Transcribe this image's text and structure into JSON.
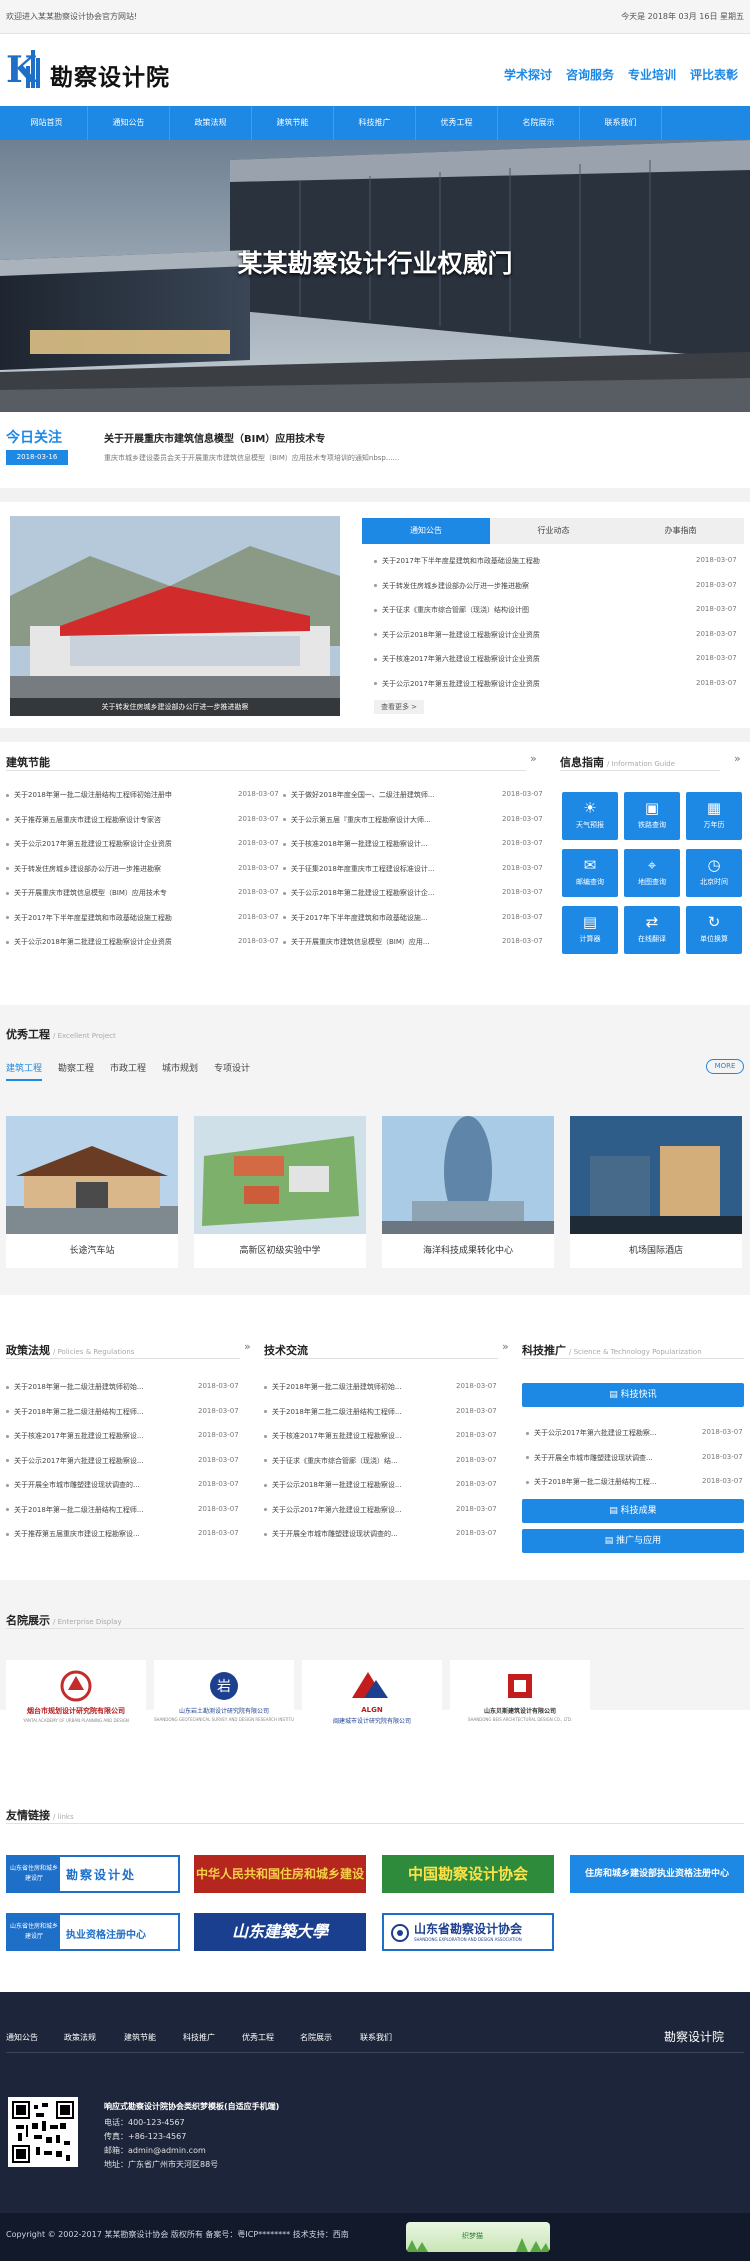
{
  "topbar": {
    "welcome": "欢迎进入某某勘察设计协会官方网站!",
    "today": "今天是 2018年 03月 16日 星期五"
  },
  "logo": {
    "k": "K",
    "name": "勘察设计院"
  },
  "header_nav": [
    "学术探讨",
    "咨询服务",
    "专业培训",
    "评比表彰"
  ],
  "main_nav": [
    "网站首页",
    "通知公告",
    "政策法规",
    "建筑节能",
    "科技推广",
    "优秀工程",
    "名院展示",
    "联系我们"
  ],
  "hero": {
    "slogan": "某某勘察设计行业权威门"
  },
  "today_focus": {
    "title": "今日关注",
    "date": "2018-03-16",
    "headline": "关于开展重庆市建筑信息模型（BIM）应用技术专",
    "summary": "重庆市城乡建设委员会关于开展重庆市建筑信息模型（BIM）应用技术专项培训的通知nbsp......"
  },
  "feature": {
    "caption": "关于转发住房城乡建设部办公厅进一步推进勘察"
  },
  "notice_tabs": [
    "通知公告",
    "行业动态",
    "办事指南"
  ],
  "notices": [
    {
      "t": "关于2017年下半年度星建筑和市政基础设施工程勘",
      "d": "2018-03-07"
    },
    {
      "t": "关于转发住房城乡建设部办公厅进一步推进勘察",
      "d": "2018-03-07"
    },
    {
      "t": "关于征求《重庆市综合管廊（现浇）结构设计图",
      "d": "2018-03-07"
    },
    {
      "t": "关于公示2018年第一批建设工程勘察设计企业资质",
      "d": "2018-03-07"
    },
    {
      "t": "关于核准2017年第六批建设工程勘察设计企业资质",
      "d": "2018-03-07"
    },
    {
      "t": "关于公示2017年第五批建设工程勘察设计企业资质",
      "d": "2018-03-07"
    }
  ],
  "notices_more": "查看更多 >",
  "energy": {
    "title": "建筑节能",
    "left": [
      {
        "t": "关于2018年第一批二级注册结构工程师初始注册申",
        "d": "2018-03-07"
      },
      {
        "t": "关于推荐第五届重庆市建设工程勘察设计专家咨",
        "d": "2018-03-07"
      },
      {
        "t": "关于公示2017年第五批建设工程勘察设计企业资质",
        "d": "2018-03-07"
      },
      {
        "t": "关于转发住房城乡建设部办公厅进一步推进勘察",
        "d": "2018-03-07"
      },
      {
        "t": "关于开展重庆市建筑信息模型（BIM）应用技术专",
        "d": "2018-03-07"
      },
      {
        "t": "关于2017年下半年度星建筑和市政基础设施工程勘",
        "d": "2018-03-07"
      },
      {
        "t": "关于公示2018年第二批建设工程勘察设计企业资质",
        "d": "2018-03-07"
      }
    ],
    "right": [
      {
        "t": "关于做好2018年度全国一、二级注册建筑师...",
        "d": "2018-03-07"
      },
      {
        "t": "关于公示第五届『重庆市工程勘察设计大师...",
        "d": "2018-03-07"
      },
      {
        "t": "关于核准2018年第一批建设工程勘察设计...",
        "d": "2018-03-07"
      },
      {
        "t": "关于征集2018年度重庆市工程建设标准设计...",
        "d": "2018-03-07"
      },
      {
        "t": "关于公示2018年第二批建设工程勘察设计企...",
        "d": "2018-03-07"
      },
      {
        "t": "关于2017年下半年度建筑和市政基础设施...",
        "d": "2018-03-07"
      },
      {
        "t": "关于开展重庆市建筑信息模型（BIM）应用...",
        "d": "2018-03-07"
      }
    ]
  },
  "guide": {
    "title": "信息指南",
    "sub": "/ Information Guide",
    "items": [
      {
        "g": "☀",
        "l": "天气预报"
      },
      {
        "g": "▣",
        "l": "铁路查询"
      },
      {
        "g": "▦",
        "l": "万年历"
      },
      {
        "g": "✉",
        "l": "邮编查询"
      },
      {
        "g": "⌖",
        "l": "地图查询"
      },
      {
        "g": "◷",
        "l": "北京时间"
      },
      {
        "g": "▤",
        "l": "计算器"
      },
      {
        "g": "⇄",
        "l": "在线翻译"
      },
      {
        "g": "↻",
        "l": "单位换算"
      }
    ]
  },
  "excellent": {
    "title": "优秀工程",
    "sub": "/ Excellent Project",
    "tabs": [
      "建筑工程",
      "勘察工程",
      "市政工程",
      "城市规划",
      "专项设计"
    ],
    "more": "MORE",
    "cards": [
      "长途汽车站",
      "高新区初级实验中学",
      "海洋科技成果转化中心",
      "机场国际酒店"
    ]
  },
  "policy": {
    "title": "政策法规",
    "sub": "/ Policies & Regulations",
    "items": [
      {
        "t": "关于2018年第一批二级注册建筑师初始...",
        "d": "2018-03-07"
      },
      {
        "t": "关于2018年第二批二级注册结构工程师...",
        "d": "2018-03-07"
      },
      {
        "t": "关于核准2017年第五批建设工程勘察设...",
        "d": "2018-03-07"
      },
      {
        "t": "关于公示2017年第六批建设工程勘察设...",
        "d": "2018-03-07"
      },
      {
        "t": "关于开展全市城市雕塑建设现状调查的...",
        "d": "2018-03-07"
      },
      {
        "t": "关于2018年第一批二级注册结构工程师...",
        "d": "2018-03-07"
      },
      {
        "t": "关于推荐第五届重庆市建设工程勘察设...",
        "d": "2018-03-07"
      }
    ]
  },
  "tech": {
    "title": "技术交流",
    "items": [
      {
        "t": "关于2018年第一批二级注册建筑师初始...",
        "d": "2018-03-07"
      },
      {
        "t": "关于2018年第二批二级注册结构工程师...",
        "d": "2018-03-07"
      },
      {
        "t": "关于核准2017年第五批建设工程勘察设...",
        "d": "2018-03-07"
      },
      {
        "t": "关于征求《重庆市综合管廊（现浇）结...",
        "d": "2018-03-07"
      },
      {
        "t": "关于公示2018年第一批建设工程勘察设...",
        "d": "2018-03-07"
      },
      {
        "t": "关于公示2017年第六批建设工程勘察设...",
        "d": "2018-03-07"
      },
      {
        "t": "关于开展全市城市雕塑建设现状调查的...",
        "d": "2018-03-07"
      }
    ]
  },
  "sci": {
    "title": "科技推广",
    "sub": "/ Science & Technology Popularization",
    "btn1": "科技快讯",
    "items": [
      {
        "t": "关于公示2017年第六批建设工程勘察...",
        "d": "2018-03-07"
      },
      {
        "t": "关于开展全市城市雕塑建设现状调查...",
        "d": "2018-03-07"
      },
      {
        "t": "关于2018年第一批二级注册结构工程...",
        "d": "2018-03-07"
      }
    ],
    "btn2": "科技成果",
    "btn3": "推广与应用"
  },
  "famous": {
    "title": "名院展示",
    "sub": "/ Enterprise Display",
    "logos": [
      {
        "name": "烟台市规划设计研究院有限公司",
        "en": "YANTAI ACADEMY OF URBAN PLANNING AND DESIGN"
      },
      {
        "name": "山东岩土勘测设计研究院有限公司",
        "en": "SHANDONG GEOTECHNICAL SURVEY AND DESIGN RESEARCH INSTITUTE"
      },
      {
        "name": "闽建城市设计研究院有限公司",
        "en": "ALGN"
      },
      {
        "name": "山东贝斯建筑设计有限公司",
        "en": "SHANDONG BEIS ARCHITECTURAL DESIGN CO., LTD."
      }
    ]
  },
  "links": {
    "title": "友情链接",
    "sub": "/ links",
    "b1a": "山东省住房和城乡建设厅",
    "b1b": "勘察设计处",
    "b2": "中华人民共和国住房和城乡建设部",
    "b3": "中国勘察设计协会",
    "b4": "住房和城乡建设部执业资格注册中心",
    "b5a": "山东省住房和城乡建设厅",
    "b5b": "执业资格注册中心",
    "b6": "山东建築大學",
    "b7a": "山东省勘察设计协会",
    "b7b": "SHANDONG EXPLORATION AND DESIGN ASSOCIATION"
  },
  "footer": {
    "nav": [
      "通知公告",
      "政策法规",
      "建筑节能",
      "科技推广",
      "优秀工程",
      "名院展示",
      "联系我们"
    ],
    "logo": "勘察设计院",
    "site": "响应式勘察设计院协会类织梦模板(自适应手机端)",
    "phone": "电话：400-123-4567",
    "fax": "传真：+86-123-4567",
    "email": "邮箱：admin@admin.com",
    "addr": "地址：广东省广州市天河区88号",
    "copyright": "Copyright © 2002-2017 某某勘察设计协会 版权所有 备案号：粤ICP********   技术支持：西南",
    "badge": "织梦猫"
  }
}
